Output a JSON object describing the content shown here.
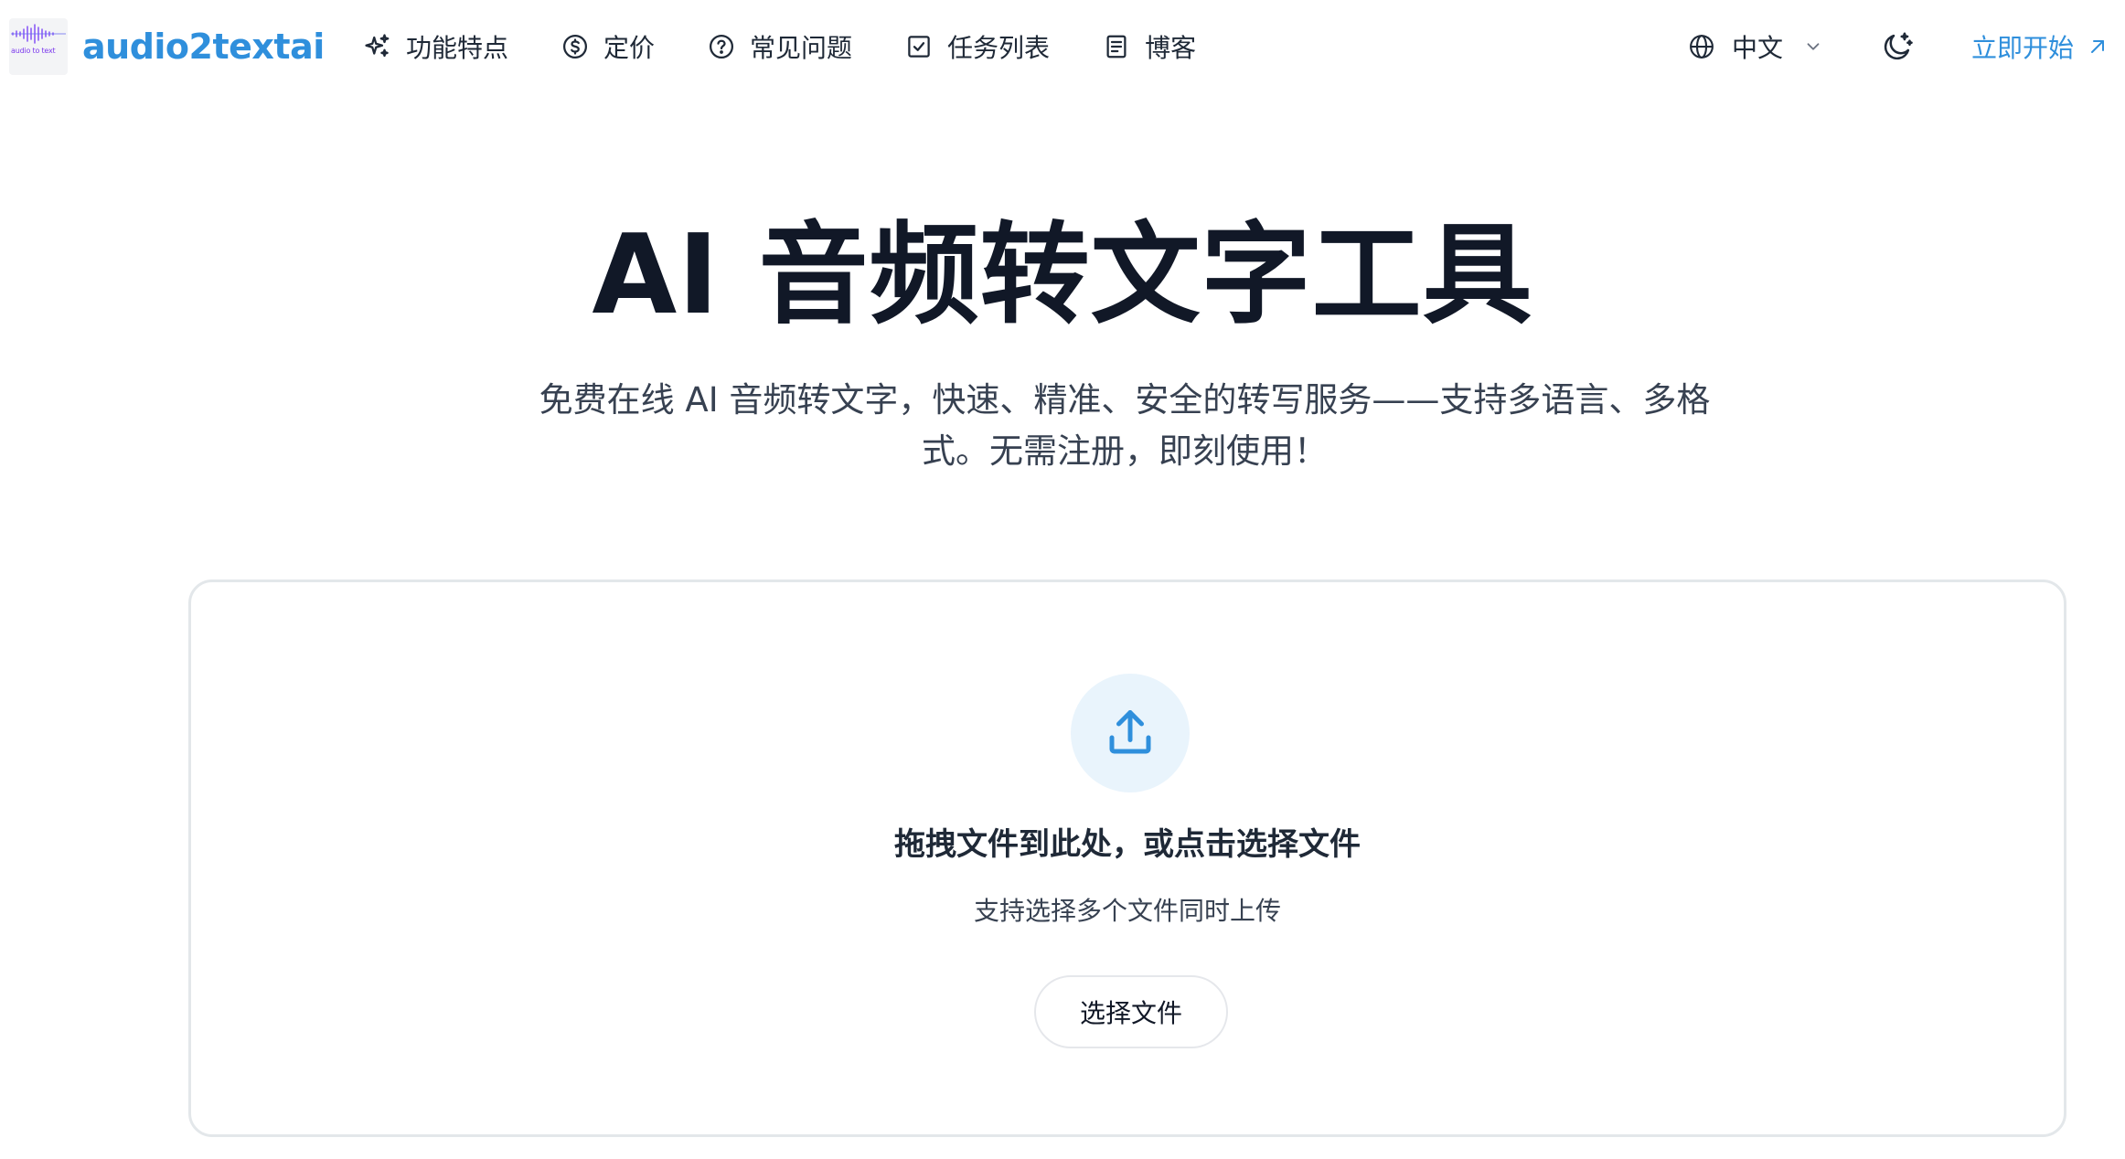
{
  "header": {
    "logo_caption": "audio to text",
    "brand": "audio2textai",
    "nav": [
      {
        "label": "功能特点",
        "icon": "sparkles-icon"
      },
      {
        "label": "定价",
        "icon": "dollar-circle-icon"
      },
      {
        "label": "常见问题",
        "icon": "question-circle-icon"
      },
      {
        "label": "任务列表",
        "icon": "checkbox-icon"
      },
      {
        "label": "博客",
        "icon": "document-icon"
      }
    ],
    "language": {
      "label": "中文",
      "icon": "globe-icon"
    },
    "theme_icon": "moon-stars-icon",
    "cta": {
      "label": "立即开始",
      "icon": "arrow-up-right-icon"
    }
  },
  "hero": {
    "title": "AI 音频转文字工具",
    "subtitle": "免费在线 AI 音频转文字，快速、精准、安全的转写服务——支持多语言、多格式。无需注册，即刻使用！"
  },
  "upload": {
    "icon": "upload-icon",
    "title": "拖拽文件到此处，或点击选择文件",
    "hint": "支持选择多个文件同时上传",
    "button_label": "选择文件"
  },
  "colors": {
    "brand": "#2f8fdc",
    "upload_icon_bg": "#e9f4fc",
    "card_border": "#e3e7ea"
  }
}
